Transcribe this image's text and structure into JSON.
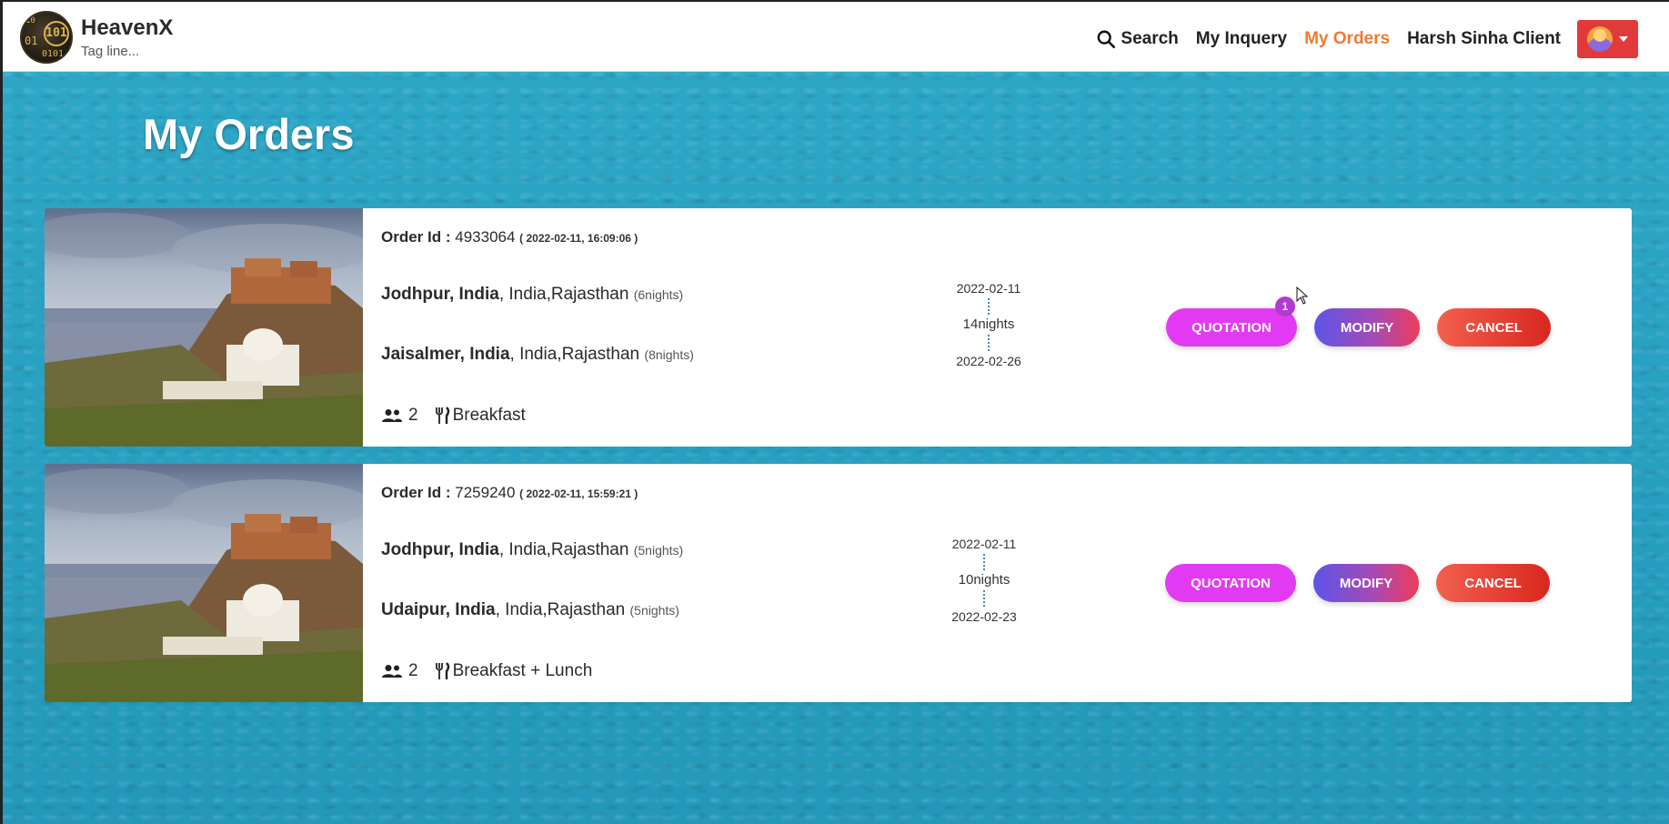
{
  "header": {
    "brand_name": "HeavenX",
    "tagline": "Tag line...",
    "logo_text": {
      "a": "10",
      "b": "01",
      "c": "101",
      "d": "0101"
    },
    "nav": {
      "search": "Search",
      "inquery": "My Inquery",
      "orders": "My Orders",
      "user": "Harsh Sinha Client"
    },
    "active_color": "#f07a30",
    "user_button_color": "#e03a3a"
  },
  "page": {
    "title": "My Orders"
  },
  "orders": [
    {
      "order_id_label": "Order Id :",
      "order_id": "4933064",
      "timestamp": "( 2022-02-11, 16:09:06 )",
      "destinations": [
        {
          "name": "Jodhpur, India",
          "region": ", India,Rajasthan",
          "nights": "(6nights)"
        },
        {
          "name": "Jaisalmer, India",
          "region": ", India,Rajasthan",
          "nights": "(8nights)"
        }
      ],
      "pax": "2",
      "meal": "Breakfast",
      "start_date": "2022-02-11",
      "total_nights": "14nights",
      "end_date": "2022-02-26",
      "quotation_badge": "1",
      "buttons": {
        "quotation": "QUOTATION",
        "modify": "MODIFY",
        "cancel": "CANCEL"
      }
    },
    {
      "order_id_label": "Order Id :",
      "order_id": "7259240",
      "timestamp": "( 2022-02-11, 15:59:21 )",
      "destinations": [
        {
          "name": "Jodhpur, India",
          "region": ", India,Rajasthan",
          "nights": "(5nights)"
        },
        {
          "name": "Udaipur, India",
          "region": ", India,Rajasthan",
          "nights": "(5nights)"
        }
      ],
      "pax": "2",
      "meal": "Breakfast + Lunch",
      "start_date": "2022-02-11",
      "total_nights": "10nights",
      "end_date": "2022-02-23",
      "buttons": {
        "quotation": "QUOTATION",
        "modify": "MODIFY",
        "cancel": "CANCEL"
      }
    }
  ],
  "colors": {
    "quotation": "#e23af2",
    "modify_from": "#5b55e8",
    "modify_to": "#ef3c5a",
    "cancel_from": "#f2604e",
    "cancel_to": "#d9271e",
    "background": "#2aa3c4"
  }
}
